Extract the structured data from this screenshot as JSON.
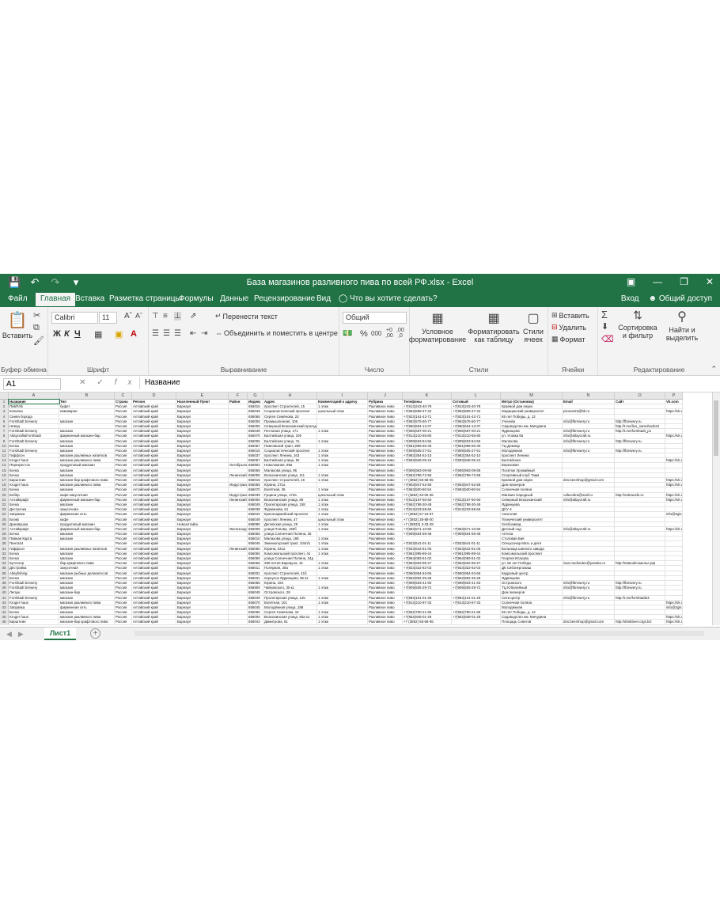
{
  "window": {
    "title": "База магазинов разливного пива по всей РФ.xlsx - Excel",
    "qat_icons": [
      "save-icon",
      "undo-icon",
      "redo-icon",
      "customize-icon"
    ]
  },
  "tabs": [
    "Файл",
    "Главная",
    "Вставка",
    "Разметка страницы",
    "Формулы",
    "Данные",
    "Рецензирование",
    "Вид"
  ],
  "tell_me": "Что вы хотите сделать?",
  "account": {
    "signin": "Вход",
    "share": "Общий доступ"
  },
  "ribbon": {
    "clipboard": {
      "paste": "Вставить",
      "label": "Буфер обмена"
    },
    "font": {
      "name": "Calibri",
      "size": "11",
      "label": "Шрифт",
      "bold": "Ж",
      "italic": "К",
      "underline": "Ч"
    },
    "alignment": {
      "wrap": "Перенести текст",
      "merge": "Объединить и поместить в центре",
      "label": "Выравнивание"
    },
    "number": {
      "format": "Общий",
      "label": "Число"
    },
    "styles": {
      "cond": "Условное форматирование",
      "table": "Форматировать как таблицу",
      "cell": "Стили ячеек",
      "label": "Стили"
    },
    "cells": {
      "insert": "Вставить",
      "delete": "Удалить",
      "format": "Формат",
      "label": "Ячейки"
    },
    "editing": {
      "sort": "Сортировка и фильтр",
      "find": "Найти и выделить",
      "label": "Редактирование"
    }
  },
  "formula_bar": {
    "cell_ref": "A1",
    "content": "Название"
  },
  "columns": [
    "A",
    "B",
    "C",
    "D",
    "E",
    "F",
    "G",
    "H",
    "I",
    "J",
    "K",
    "L",
    "M",
    "N",
    "O",
    "P"
  ],
  "header_row": [
    "Название",
    "Тип",
    "Страна",
    "Регион",
    "Населенный Пункт",
    "Район",
    "Индекс",
    "Адрес",
    "Комментарий к адресу",
    "Рубрика",
    "Телефоны",
    "Сотовый",
    "Метро (Остановка)",
    "Email",
    "Сайт",
    "Vk.com"
  ],
  "rows": [
    [
      "ПивПАБ",
      "буфет",
      "Россия",
      "Алтайский край",
      "Барнаул",
      "",
      "656015",
      "проспект Строителей, 15",
      "1 этаж",
      "Разливное пиво",
      "+7(913)243-40-78",
      "+7(913)243-40-78",
      "Краевой дом науки",
      "",
      "",
      ""
    ],
    [
      "Копилка",
      "пивоварня",
      "Россия",
      "Алтайский край",
      "Барнаул",
      "",
      "656049",
      "Социалистический проспект",
      "цокольный этаж",
      "Разливное пиво",
      "+7(962)808-47-42",
      "+7(962)808-47-42",
      "Медицинский университет",
      "pivovar22@bk.ru",
      "",
      "https://vk.com"
    ],
    [
      "Синяя борода",
      "",
      "Россия",
      "Алтайский край",
      "Барнаул",
      "",
      "656065",
      "Сергея Семёнова, 23",
      "",
      "Разливное пиво",
      "+7(923)161-42-71",
      "+7(923)161-42-71",
      "65 лет Победы, д. 12",
      "",
      "",
      ""
    ],
    [
      "Forshtadt brewery",
      "магазин",
      "Россия",
      "Алтайский край",
      "Барнаул",
      "",
      "656006",
      "Промышленная, 106",
      "",
      "Разливное пиво",
      "+7(963)575-60-77",
      "+7(963)575-60-77",
      "Ученова",
      "info@fbrewery.ru",
      "http://fbrewery.ru",
      ""
    ],
    [
      "Невод",
      "",
      "Россия",
      "Алтайский край",
      "Барнаул",
      "",
      "656006",
      "Северный Власихинский проезд, 10",
      "",
      "Разливное пиво",
      "+7(960)604-13-37",
      "+7(960)604-13-37",
      "Садоводство им. Мичурина",
      "",
      "http://t.me/livo_samohodn22",
      ""
    ],
    [
      "Forshtadt brewery",
      "магазин",
      "Россия",
      "Алтайский край",
      "Барнаул",
      "",
      "656049",
      "Песчаная улица, 171",
      "1 этаж",
      "Разливное пиво",
      "+7(906)697-00-21",
      "+7(906)697-00-21",
      "Ядринцева",
      "info@fbrewery.ru",
      "http://t.me/forshtadt_p1",
      ""
    ],
    [
      "Altaycraft&Forshtadt",
      "фирменный магазин-бар",
      "Россия",
      "Алтайский край",
      "Барнаул",
      "",
      "656070",
      "Балтийская улица, 105",
      "",
      "Разливное пиво",
      "+7(913)210-55-80",
      "+7(913)210-55-80",
      "ул. Усовка 55",
      "info@altaycraft.ru",
      "",
      "https://vk.com"
    ],
    [
      "Forshtadt brewery",
      "магазин",
      "Россия",
      "Алтайский край",
      "Барнаул",
      "",
      "656006",
      "Балтийская улица, 7а",
      "1 этаж",
      "Разливное пиво",
      "+7(909)503-84-56",
      "+7(909)503-84-56",
      "Малахова",
      "info@fbrewery.ru",
      "http://fbrewery.ru",
      ""
    ],
    [
      "Бочка",
      "магазин",
      "Россия",
      "Алтайский край",
      "Барнаул",
      "",
      "656067",
      "Павловский тракт, 289",
      "",
      "Разливное пиво",
      "+7(961)996-66-30",
      "+7(961)996-66-30",
      "ТЦ Домнар",
      "",
      "",
      ""
    ],
    [
      "Forshtadt brewery",
      "магазин",
      "Россия",
      "Алтайский край",
      "Барнаул",
      "",
      "656015",
      "Социалистический проспект",
      "1 этаж",
      "Разливное пиво",
      "+7(909)505-27-61",
      "+7(909)505-27-61",
      "Молодёжная",
      "info@fbrewery.ru",
      "http://fbrewery.ru",
      ""
    ],
    [
      "Гиффсон",
      "магазин разливных напитков",
      "Россия",
      "Алтайский край",
      "Барнаул",
      "",
      "656037",
      "проспект Ленина, 163",
      "1 этаж",
      "Разливное пиво",
      "+7(983)354-52-10",
      "+7(983)354-52-10",
      "проспект Ленина",
      "",
      "",
      ""
    ],
    [
      "Kruger haus",
      "магазин разливного пива",
      "Россия",
      "Алтайский край",
      "Барнаул",
      "",
      "656067",
      "Балтийская улица, 92",
      "1 этаж",
      "Разливное пиво",
      "+7(903)948-05-24",
      "+7(903)948-05-24",
      "Балтийская",
      "",
      "",
      "https://vk.com"
    ],
    [
      "Перекресток",
      "продуктовый магазин",
      "Россия",
      "Алтайский край",
      "Барнаул",
      "Октябрьский",
      "656902",
      "Новоломная, 89а",
      "1 этаж",
      "Разливное пиво",
      "",
      "",
      "Березовая",
      "",
      "",
      ""
    ],
    [
      "Бочка",
      "магазин",
      "Россия",
      "Алтайский край",
      "Барнаул",
      "",
      "656066",
      "Малахова улица, 96",
      "",
      "Разливное пиво",
      "+7(906)963-09-59",
      "+7(906)963-09-59",
      "Посёлок Урожайный",
      "",
      "",
      ""
    ],
    [
      "Бочка",
      "магазин",
      "Россия",
      "Алтайский край",
      "Барнаул",
      "Ленинский",
      "656006",
      "Власихинская улица, 111",
      "1 этаж",
      "Разливное пиво",
      "+7(962)799-72-58",
      "+7(962)799-72-58",
      "Спортивный клуб Таим",
      "",
      "",
      ""
    ],
    [
      "Бирштеин",
      "магазин-бар крафтового пива",
      "Россия",
      "Алтайский край",
      "Барнаул",
      "",
      "656015",
      "проспект Строителей, 16",
      "1 этаж",
      "Разливное пиво",
      "+7 (3852) 55-68-65",
      "",
      "Краевой дом науки",
      "dns.beershop@gmail.com",
      "",
      "https://vk.com"
    ],
    [
      "Kruger haus",
      "магазин разливного пива",
      "Россия",
      "Алтайский край",
      "Барнаул",
      "Индустриальный",
      "656055",
      "Юрина, 271а",
      "",
      "Разливное пиво",
      "+7(903)947-62-59",
      "+7(903)947-62-59",
      "Дом пионеров",
      "",
      "",
      "https://vk.com"
    ],
    [
      "Бочка",
      "магазин",
      "Россия",
      "Алтайский край",
      "Барнаул",
      "",
      "656070",
      "Взлётная, 39",
      "1 этаж",
      "Разливное пиво",
      "+7(963)500-80-54",
      "+7(963)500-80-54",
      "Солнечная поляна",
      "",
      "",
      ""
    ],
    [
      "Бобёр",
      "кафе-закусочная",
      "Россия",
      "Алтайский край",
      "Барнаул",
      "Индустриальный",
      "656039",
      "Гущина улица, 173а",
      "цокольный этаж",
      "Разливное пиво",
      "+7 (3852) 34-00-36",
      "",
      "Магазин Народный",
      "cafevobra@mail.ru",
      "http://vobracafe.ru",
      "https://vk.com"
    ],
    [
      "Алтайкрафт",
      "фирменный магазин-бар",
      "Россия",
      "Алтайский край",
      "Барнаул",
      "Ленинский",
      "656006",
      "Власихинская улица, 89",
      "1 этаж",
      "Разливное пиво",
      "+7(913)167-60-60",
      "+7(913)167-60-60",
      "Северный Власихинский",
      "info@altaycraft.ru",
      "",
      "https://vk.com"
    ],
    [
      "Бочка",
      "магазин",
      "Россия",
      "Алтайский край",
      "Барнаул",
      "",
      "656049",
      "Пролетарская улица, 158",
      "1 этаж",
      "Разливное пиво",
      "+7(962)798-30-49",
      "+7(962)798-30-49",
      "Ядринцева",
      "",
      "",
      ""
    ],
    [
      "Дестрочка",
      "закусочная",
      "Россия",
      "Алтайский край",
      "Барнаул",
      "",
      "656038",
      "Фурманова, 61",
      "1 этаж",
      "Разливное пиво",
      "+7(913)233-58-66",
      "+7(913)233-58-66",
      "ДСУ-4",
      "",
      "",
      ""
    ],
    [
      "Заправка",
      "фирменная сеть",
      "Россия",
      "Алтайский край",
      "Барнаул",
      "",
      "656043",
      "Красноармейский проспект",
      "1 этаж",
      "Разливное пиво",
      "+7 (3852) 57-24-57",
      "",
      "Анатолия",
      "",
      "",
      "info@2gis.tilda.ws/proxy"
    ],
    [
      "Блэкв",
      "кафе",
      "Россия",
      "Алтайский край",
      "Барнаул",
      "",
      "656049",
      "проспект Ленина, 47",
      "цокольный этаж",
      "Разливное пиво",
      "+7 (3852) 35-88-00",
      "",
      "Технический университет",
      "",
      "",
      ""
    ],
    [
      "Домовушка",
      "продуктовый магазин",
      "Россия",
      "Алтайский край",
      "Новоалтайск",
      "",
      "658080",
      "Деповская улица, 29",
      "1 этаж",
      "Разливное пиво",
      "+7 (38532) 3-33-29",
      "",
      "Хлебозавод",
      "",
      "",
      ""
    ],
    [
      "Алтайкрафт",
      "фирменный магазин-бар",
      "Россия",
      "Алтайский край",
      "Барнаул",
      "Железнодорожный",
      "656008",
      "улица Попова, 150б",
      "1 этаж",
      "Разливное пиво",
      "+7(963)571-10-80",
      "+7(963)571-10-80",
      "Детский сад",
      "info@altaycraft.ru",
      "",
      "https://vk.com"
    ],
    [
      "Бочка",
      "магазин",
      "Россия",
      "Алтайский край",
      "Барнаул",
      "",
      "656065",
      "улица Солнечная Поляна, 26",
      "",
      "Разливное пиво",
      "+7(909)504-59-48",
      "+7(909)504-59-48",
      "Аптека",
      "",
      "",
      ""
    ],
    [
      "Пивная Карта",
      "магазин",
      "Россия",
      "Алтайский край",
      "Барнаул",
      "",
      "656010",
      "Малахова улица, 188",
      "1 этаж",
      "Разливное пиво",
      "",
      "",
      "Столовая Бия",
      "",
      "",
      ""
    ],
    [
      "Пинта24",
      "",
      "Россия",
      "Алтайский край",
      "Барнаул",
      "",
      "656045",
      "Змеиногорский тракт, 104п/1",
      "1 этаж",
      "Разливное пиво",
      "+7(923)641-01-11",
      "+7(923)641-01-11",
      "Спецхозчар Мать и дитя",
      "",
      "",
      ""
    ],
    [
      "Гиффсон",
      "магазин разливных напитков",
      "Россия",
      "Алтайский край",
      "Барнаул",
      "Ленинский",
      "656060",
      "Юрина, 221а",
      "1 этаж",
      "Разливное пиво",
      "+7(923)642-81-05",
      "+7(923)642-81-05",
      "Больница шинного завода",
      "",
      "",
      ""
    ],
    [
      "Бочка",
      "магазин",
      "Россия",
      "Алтайский край",
      "Барнаул",
      "",
      "656056",
      "Комсомольский проспект, 44",
      "1 этаж",
      "Разливное пиво",
      "+7(961)995-89-44",
      "+7(961)995-89-44",
      "Комсомольский проспект",
      "",
      "",
      ""
    ],
    [
      "Бочка",
      "магазин",
      "Россия",
      "Алтайский край",
      "Барнаул",
      "",
      "656060",
      "улица Солнечная Поляна, 24д",
      "",
      "Разливное пиво",
      "+7(964)083-51-02",
      "+7(964)083-51-02",
      "Георгия Исакова",
      "",
      "",
      ""
    ],
    [
      "Бутлегер",
      "бар крафтового пива",
      "Россия",
      "Алтайский край",
      "Барнаул",
      "",
      "656065",
      "280-летия Барнаула, 15",
      "1 этаж",
      "Разливное пиво",
      "+7(964)602-95-27",
      "+7(964)602-95-27",
      "ул. 65 лет Победы",
      "ivan.medvedev@yandex.ru",
      "http://пивнойсомелье.рф",
      ""
    ],
    [
      "Дестройка",
      "закусочная",
      "Россия",
      "Алтайский край",
      "Барнаул",
      "",
      "656011",
      "Полярная, 28а",
      "1 этаж",
      "Разливное пиво",
      "+7(923)322-82-03",
      "+7(923)322-82-03",
      "ДК Сибэнергомаш",
      "",
      "",
      ""
    ],
    [
      "Altayfishing",
      "магазин рыбных деликатесов",
      "Россия",
      "Алтайский край",
      "Барнаул",
      "",
      "656031",
      "проспект Строителей, 41б",
      "",
      "Разливное пиво",
      "+7(960)954-63-66",
      "+7(960)954-63-66",
      "Кадровый центр",
      "",
      "",
      ""
    ],
    [
      "Бочка",
      "магазин",
      "Россия",
      "Алтайский край",
      "Барнаул",
      "",
      "656031",
      "переулок Ядринцева, 96 к2",
      "1 этаж",
      "Разливное пиво",
      "+7(962)802-35-28",
      "+7(962)802-35-28",
      "Ядринцева",
      "",
      "",
      ""
    ],
    [
      "Forshtadt brewery",
      "магазин",
      "Россия",
      "Алтайский край",
      "Барнаул",
      "",
      "656055",
      "Юрина, 184",
      "",
      "Разливное пиво",
      "+7(909)503-41-60",
      "+7(909)503-41-60",
      "Островского",
      "info@fbrewery.ru",
      "http://fbrewery.ru",
      ""
    ],
    [
      "Forshtadt brewery",
      "магазин",
      "Россия",
      "Алтайский край",
      "Барнаул",
      "",
      "656906",
      "Чайковского, 35 к1",
      "1 этаж",
      "Разливное пиво",
      "+7(909)505-29-72",
      "+7(909)505-29-72",
      "ТЦ Юбилейный",
      "info@fbrewery.ru",
      "http://fbrewery.ru",
      ""
    ],
    [
      "Лепуш",
      "магазин-бар",
      "Россия",
      "Алтайский край",
      "Барнаул",
      "",
      "656049",
      "Островского, 28",
      "",
      "Разливное пиво",
      "",
      "",
      "Дом пионеров",
      "",
      "",
      ""
    ],
    [
      "Forshtadt brewery",
      "магазин",
      "Россия",
      "Алтайский край",
      "Барнаул",
      "",
      "656049",
      "Пролетарская улица, 125",
      "1 этаж",
      "Разливное пиво",
      "+7(963)101-01-29",
      "+7(963)101-01-29",
      "Сити-центр",
      "info@fbrewery.ru",
      "http://t.me/forshtadt24",
      ""
    ],
    [
      "Kruger haus",
      "магазин разливного пива",
      "Россия",
      "Алтайский край",
      "Барнаул",
      "",
      "656070",
      "Взлётная, 101",
      "1 этаж",
      "Разливное пиво",
      "+7(913)210-97-33",
      "+7(913)210-97-33",
      "Солнечная поляна",
      "",
      "",
      "https://vk.com"
    ],
    [
      "Заправка",
      "фирменная сеть",
      "Россия",
      "Алтайский край",
      "Барнаул",
      "",
      "656045",
      "Молодёжная улица, 188",
      "",
      "Разливное пиво",
      "",
      "",
      "Молодёжная",
      "",
      "",
      "info@2gis.tilda.ws/proxy"
    ],
    [
      "Бочка",
      "магазин",
      "Россия",
      "Алтайский край",
      "Барнаул",
      "",
      "656065",
      "Сергея Семёнова, 16",
      "1 этаж",
      "Разливное пиво",
      "+7(962)790-21-85",
      "+7(962)790-21-85",
      "65 лет Победы, д. 12",
      "",
      "",
      ""
    ],
    [
      "Kruger haus",
      "магазин разливного пива",
      "Россия",
      "Алтайский край",
      "Барнаул",
      "",
      "656006",
      "Власихинская улица, 65а к1",
      "1 этаж",
      "Разливное пиво",
      "+7(962)848-01-29",
      "+7(962)848-01-29",
      "Садоводство им. Мичурина",
      "",
      "",
      "https://vk.com"
    ],
    [
      "Бирштеин",
      "магазин-бар крафтового пива",
      "Россия",
      "Алтайский край",
      "Барнаул",
      "",
      "656043",
      "Димитрова, 81",
      "1 этаж",
      "Разливное пиво",
      "+7 (3852) 55-68-65",
      "",
      "Площадь Советов",
      "dns.beershop@gmail.com",
      "http://drinkbeer.orgs.biz",
      "https://vk.com"
    ]
  ],
  "sheet": {
    "name": "Лист1"
  }
}
